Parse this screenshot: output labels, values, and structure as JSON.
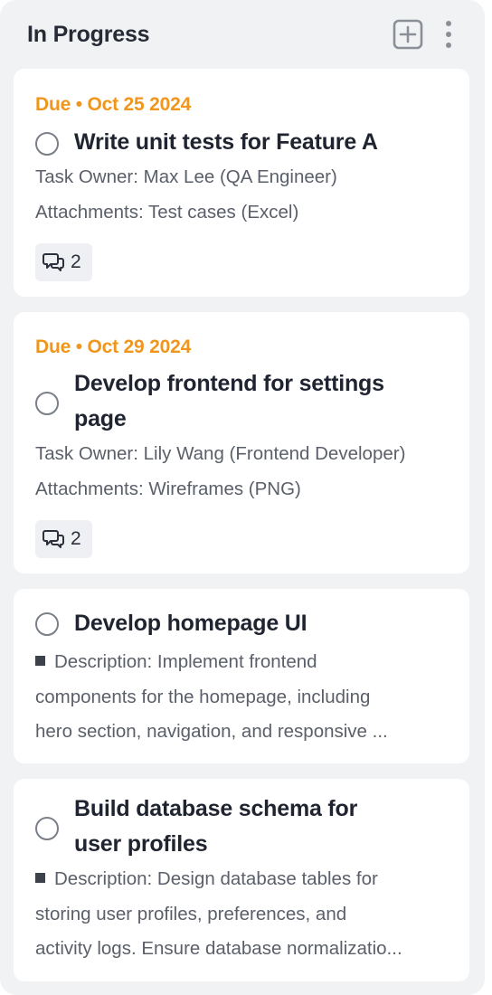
{
  "column": {
    "title": "In Progress",
    "add_icon": "plus-square-icon",
    "more_icon": "vertical-ellipsis-icon"
  },
  "cards": [
    {
      "due": "Due • Oct 25 2024",
      "title": "Write unit tests for Feature A",
      "owner": "Task Owner: Max Lee (QA Engineer)",
      "attachments": "Attachments: Test cases (Excel)",
      "comments": "2",
      "comment_icon": "comments-icon"
    },
    {
      "due": "Due • Oct 29 2024",
      "title_line1": "Develop frontend for settings",
      "title_line2": "page",
      "owner": "Task Owner: Lily Wang (Frontend Developer)",
      "attachments": "Attachments: Wireframes (PNG)",
      "comments": "2",
      "comment_icon": "comments-icon"
    },
    {
      "title": "Develop homepage UI",
      "desc_line1": "Description: Implement frontend",
      "desc_line2": "components for the homepage, including",
      "desc_line3": "hero section, navigation, and responsive ..."
    },
    {
      "title_line1": "Build database schema for",
      "title_line2": "user profiles",
      "desc_line1": "Description: Design database tables for",
      "desc_line2": "storing user profiles, preferences, and",
      "desc_line3": "activity logs. Ensure database normalizatio..."
    }
  ],
  "colors": {
    "due": "#f0961d",
    "column_bg": "#f1f2f4",
    "card_bg": "#ffffff",
    "title": "#1f2430",
    "meta": "#5a5f69"
  }
}
